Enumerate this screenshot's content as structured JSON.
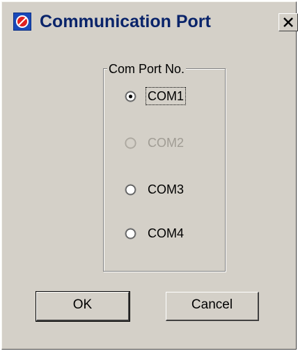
{
  "window": {
    "title": "Communication Port"
  },
  "group": {
    "label": "Com Port No."
  },
  "options": [
    {
      "label": "COM1",
      "selected": true,
      "enabled": true,
      "focused": true
    },
    {
      "label": "COM2",
      "selected": false,
      "enabled": false,
      "focused": false
    },
    {
      "label": "COM3",
      "selected": false,
      "enabled": true,
      "focused": false
    },
    {
      "label": "COM4",
      "selected": false,
      "enabled": true,
      "focused": false
    }
  ],
  "buttons": {
    "ok_label": "OK",
    "cancel_label": "Cancel"
  },
  "icons": {
    "app_icon": "app-icon",
    "close_icon": "close-icon"
  },
  "colors": {
    "dialog_bg": "#d4d0c8",
    "title_text": "#0a246a",
    "disabled_text": "#a09c94"
  }
}
